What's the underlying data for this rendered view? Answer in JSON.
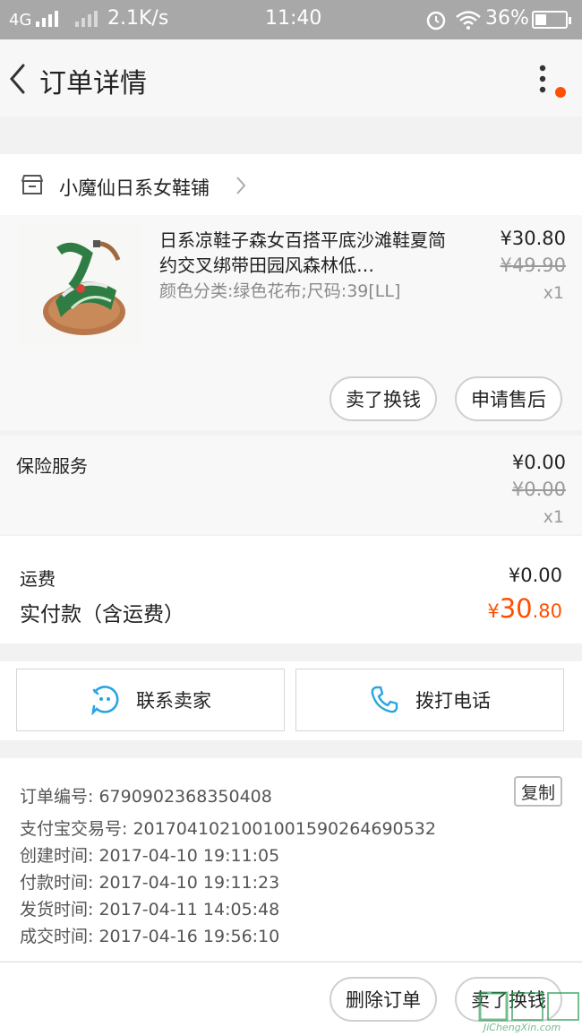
{
  "status_bar": {
    "network": "4G",
    "speed": "2.1K/s",
    "time": "11:40",
    "battery": "36%"
  },
  "nav": {
    "title": "订单详情"
  },
  "shop": {
    "name": "小魔仙日系女鞋铺"
  },
  "item": {
    "title": "日系凉鞋子森女百搭平底沙滩鞋夏简约交叉绑带田园风森林低…",
    "sku": "颜色分类:绿色花布;尺码:39[LL]",
    "price_now": "¥30.80",
    "price_old": "¥49.90",
    "qty": "x1",
    "actions": [
      "卖了换钱",
      "申请售后"
    ]
  },
  "insurance": {
    "label": "保险服务",
    "price_now": "¥0.00",
    "price_old": "¥0.00",
    "qty": "x1"
  },
  "payment": {
    "shipping_label": "运费",
    "shipping_value": "¥0.00",
    "total_label": "实付款（含运费）",
    "total_currency": "¥",
    "total_int": "30",
    "total_dec": ".80"
  },
  "contact": {
    "seller": "联系卖家",
    "call": "拨打电话"
  },
  "order_info": {
    "order_no": "订单编号: 6790902368350408",
    "copy": "复制",
    "alipay_no": "支付宝交易号: 2017041021001001590264690532",
    "created": "创建时间: 2017-04-10 19:11:05",
    "paid": "付款时间: 2017-04-10 19:11:23",
    "shipped": "发货时间: 2017-04-11 14:05:48",
    "completed": "成交时间: 2017-04-16 19:56:10"
  },
  "footer": {
    "delete": "删除订单",
    "resell": "卖了换钱"
  },
  "watermark": {
    "text": "JiChengXin.com"
  },
  "colors": {
    "accent": "#ff5000",
    "statusbar": "#a8a8a8",
    "contact_icon": "#2aa5e0"
  }
}
